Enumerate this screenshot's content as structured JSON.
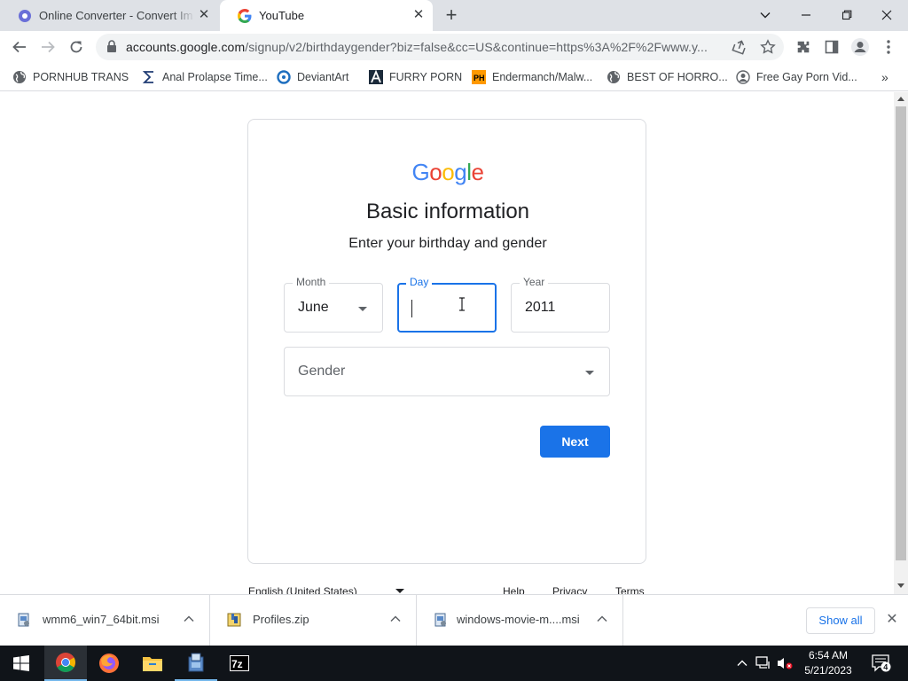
{
  "browser": {
    "tabs": [
      {
        "title": "Online Converter - Convert Im",
        "favicon": "converter-icon",
        "active": false
      },
      {
        "title": "YouTube",
        "favicon": "google-g-icon",
        "active": true
      }
    ],
    "new_tab": "+",
    "window_controls": [
      "chevron-down-icon",
      "minimize-icon",
      "restore-icon",
      "close-icon"
    ]
  },
  "toolbar": {
    "url_host": "accounts.google.com",
    "url_path": "/signup/v2/birthdaygender?biz=false&cc=US&continue=https%3A%2F%2Fwww.y..."
  },
  "bookmarks": [
    {
      "label": "PORNHUB TRANS",
      "icon": "globe-icon"
    },
    {
      "label": "Anal Prolapse Time...",
      "icon": "sigma-icon"
    },
    {
      "label": "DeviantArt",
      "icon": "deviantart-icon"
    },
    {
      "label": "FURRY PORN",
      "icon": "a-logo-icon"
    },
    {
      "label": "Endermanch/Malw...",
      "icon": "ph-icon"
    },
    {
      "label": "BEST OF HORRO...",
      "icon": "globe-icon"
    },
    {
      "label": "Free Gay Porn Vid...",
      "icon": "avatar-icon"
    }
  ],
  "signup": {
    "logo": [
      "G",
      "o",
      "o",
      "g",
      "l",
      "e"
    ],
    "logo_colors": [
      "#4285f4",
      "#ea4335",
      "#fbbc05",
      "#4285f4",
      "#34a853",
      "#ea4335"
    ],
    "heading": "Basic information",
    "subheading": "Enter your birthday and gender",
    "month": {
      "label": "Month",
      "value": "June"
    },
    "day": {
      "label": "Day",
      "value": ""
    },
    "year": {
      "label": "Year",
      "value": "2011"
    },
    "gender": {
      "placeholder": "Gender"
    },
    "next_label": "Next",
    "accent": "#1a73e8"
  },
  "footer": {
    "language": "English (United States)",
    "links": [
      "Help",
      "Privacy",
      "Terms"
    ]
  },
  "downloads": {
    "items": [
      {
        "name": "wmm6_win7_64bit.msi",
        "icon": "msi-installer-icon"
      },
      {
        "name": "Profiles.zip",
        "icon": "zip-archive-icon"
      },
      {
        "name": "windows-movie-m....msi",
        "icon": "msi-installer-icon"
      }
    ],
    "show_all": "Show all"
  },
  "taskbar": {
    "apps": [
      "start-icon",
      "chrome-icon",
      "firefox-icon",
      "file-explorer-icon",
      "installer-icon",
      "7zip-icon"
    ],
    "time": "6:54 AM",
    "date": "5/21/2023",
    "notification_count": "4"
  }
}
